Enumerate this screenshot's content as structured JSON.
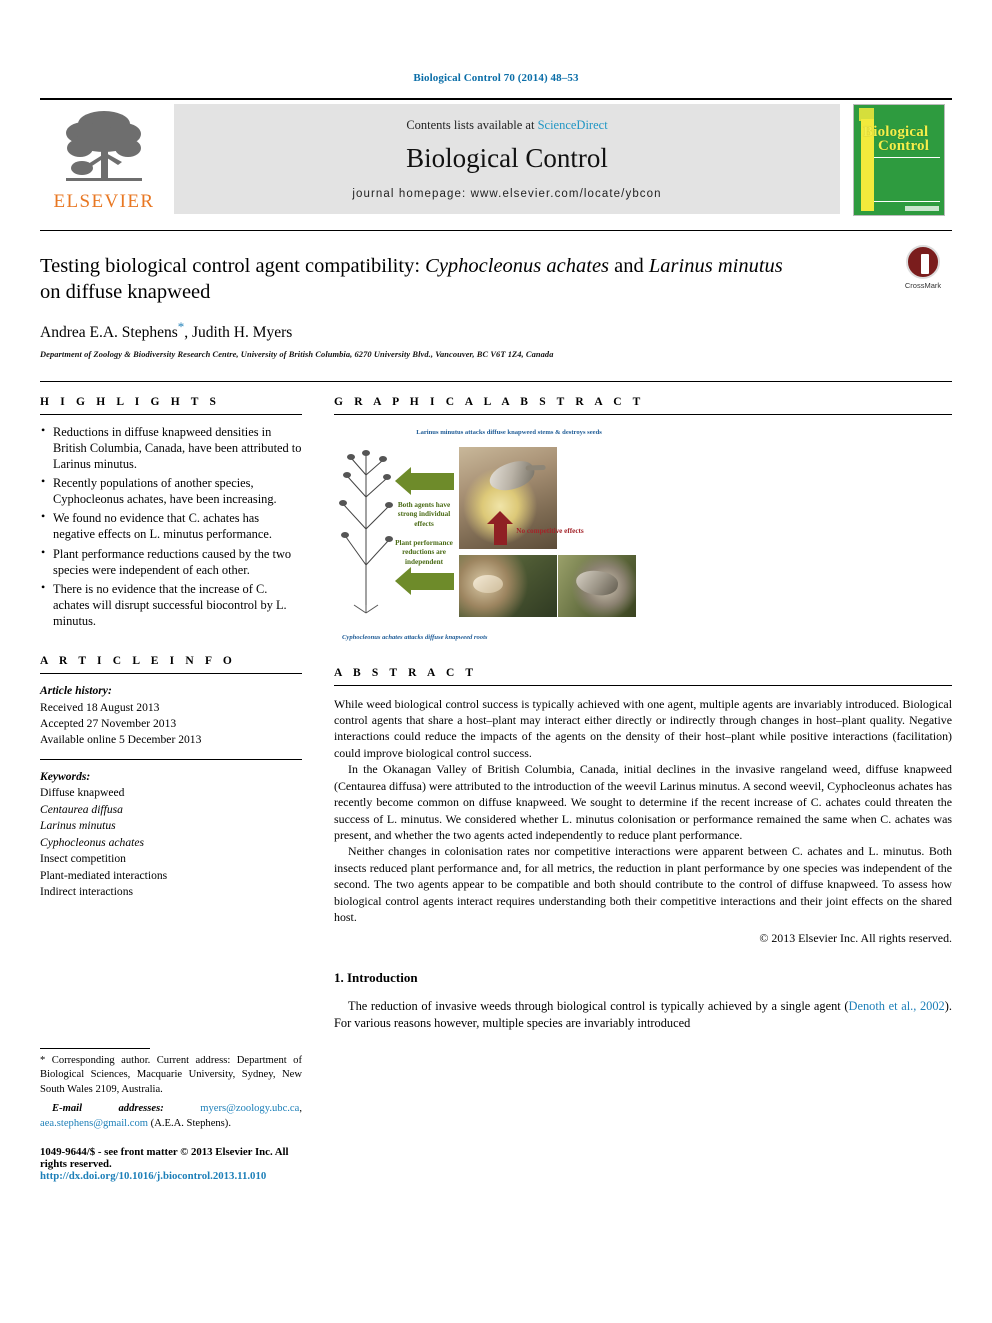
{
  "running_head": "Biological Control 70 (2014) 48–53",
  "masthead": {
    "contents_prefix": "Contents lists available at ",
    "sciencedirect": "ScienceDirect",
    "journal_title": "Biological Control",
    "homepage": "journal homepage: www.elsevier.com/locate/ybcon",
    "publisher_name": "ELSEVIER",
    "cover_line1": "Biological",
    "cover_line2": "Control"
  },
  "title": {
    "line1_pre": "Testing biological control agent compatibility: ",
    "line1_it": "Cyphocleonus achates",
    "line2_pre": "and ",
    "line2_it": "Larinus minutus",
    "line2_post": " on diffuse knapweed"
  },
  "authors": {
    "first": "Andrea E.A. Stephens",
    "corresponding_marker": "*",
    "second": ", Judith H. Myers",
    "affiliation": "Department of Zoology & Biodiversity Research Centre, University of British Columbia, 6270 University Blvd., Vancouver, BC V6T 1Z4, Canada"
  },
  "crossmark": {
    "label": "CrossMark"
  },
  "sections": {
    "highlights_head": "H I G H L I G H T S",
    "graphical_abstract_head": "G R A P H I C A L   A B S T R A C T",
    "article_info_head": "A R T I C L E   I N F O",
    "abstract_head": "A B S T R A C T",
    "introduction_head": "1. Introduction"
  },
  "highlights": [
    "Reductions in diffuse knapweed densities in British Columbia, Canada, have been attributed to Larinus minutus.",
    "Recently populations of another species, Cyphocleonus achates, have been increasing.",
    "We found no evidence that C. achates has negative effects on L. minutus performance.",
    "Plant performance reductions caused by the two species were independent of each other.",
    "There is no evidence that the increase of C. achates will disrupt successful biocontrol by L. minutus."
  ],
  "article_history": {
    "label": "Article history:",
    "received": "Received 18 August 2013",
    "accepted": "Accepted 27 November 2013",
    "available": "Available online 5 December 2013"
  },
  "keywords": {
    "label": "Keywords:",
    "items": [
      "Diffuse knapweed",
      "Centaurea diffusa",
      "Larinus minutus",
      "Cyphocleonus achates",
      "Insect competition",
      "Plant-mediated interactions",
      "Indirect interactions"
    ]
  },
  "graphical_abstract": {
    "caption_top": "Larinus minutus attacks diffuse knapweed stems & destroys seeds",
    "caption_bottom": "Cyphocleonus achates attacks diffuse knapweed roots",
    "label_effects": "Both agents have strong individual effects",
    "label_independent": "Plant performance reductions are independent",
    "label_no_competition": "No competitive effects"
  },
  "abstract": {
    "p1": "While weed biological control success is typically achieved with one agent, multiple agents are invariably introduced. Biological control agents that share a host–plant may interact either directly or indirectly through changes in host–plant quality. Negative interactions could reduce the impacts of the agents on the density of their host–plant while positive interactions (facilitation) could improve biological control success.",
    "p2": "In the Okanagan Valley of British Columbia, Canada, initial declines in the invasive rangeland weed, diffuse knapweed (Centaurea diffusa) were attributed to the introduction of the weevil Larinus minutus. A second weevil, Cyphocleonus achates has recently become common on diffuse knapweed. We sought to determine if the recent increase of C. achates could threaten the success of L. minutus. We considered whether L. minutus colonisation or performance remained the same when C. achates was present, and whether the two agents acted independently to reduce plant performance.",
    "p3": "Neither changes in colonisation rates nor competitive interactions were apparent between C. achates and L. minutus. Both insects reduced plant performance and, for all metrics, the reduction in plant performance by one species was independent of the second. The two agents appear to be compatible and both should contribute to the control of diffuse knapweed. To assess how biological control agents interact requires understanding both their competitive interactions and their joint effects on the shared host.",
    "copyright": "© 2013 Elsevier Inc. All rights reserved."
  },
  "introduction": {
    "text_pre": "The reduction of invasive weeds through biological control is typically achieved by a single agent (",
    "citation": "Denoth et al., 2002",
    "text_post": "). For various reasons however, multiple species are invariably introduced"
  },
  "footer": {
    "corresponding_note": "* Corresponding author. Current address: Department of Biological Sciences, Macquarie University, Sydney, New South Wales 2109, Australia.",
    "email_label": "E-mail addresses:",
    "email1": "myers@zoology.ubc.ca",
    "email_sep": ", ",
    "email2": "aea.stephens@gmail.com",
    "email_attrib": " (A.E.A. Stephens).",
    "issn_line": "1049-9644/$ - see front matter © 2013 Elsevier Inc. All rights reserved.",
    "doi": "http://dx.doi.org/10.1016/j.biocontrol.2013.11.010"
  },
  "colors": {
    "link_blue": "#1d7fb8",
    "elsevier_orange": "#e87722",
    "cover_green": "#2e9b3f",
    "cover_yellow": "#f2ea3c",
    "figure_green": "#6e8b2a",
    "figure_red": "#8f2024"
  }
}
